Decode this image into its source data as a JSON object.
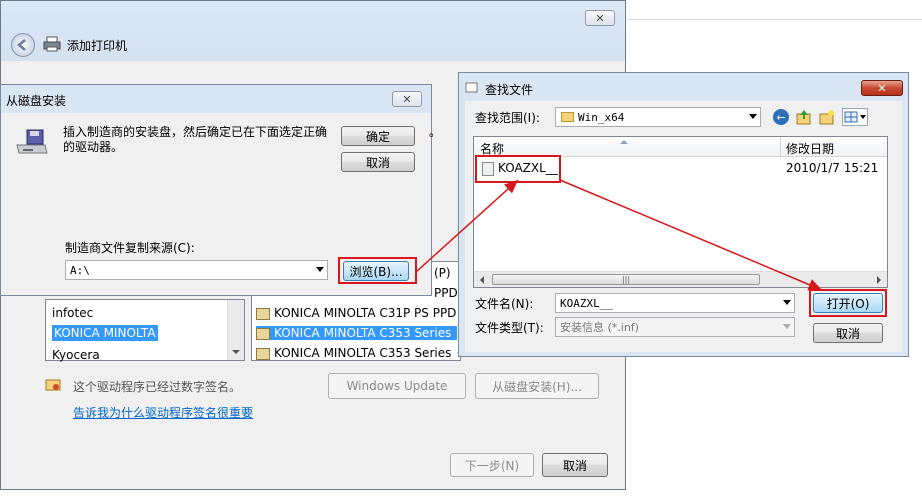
{
  "wizard": {
    "title": "添加打印机",
    "manufacturers": [
      "infotec",
      "KONICA MINOLTA",
      "Kyocera"
    ],
    "selected_manufacturer": "KONICA MINOLTA",
    "printers_partial": [
      "(P)",
      "PPD"
    ],
    "printers": [
      "KONICA MINOLTA C31P PS PPD",
      "KONICA MINOLTA C353 Series",
      "KONICA MINOLTA C353 Series"
    ],
    "signed_text": "这个驱动程序已经过数字签名。",
    "signing_link": "告诉我为什么驱动程序签名很重要",
    "windows_update": "Windows Update",
    "have_disk": "从磁盘安装(H)...",
    "next": "下一步(N)",
    "cancel": "取消",
    "close": "✕"
  },
  "disk_dialog": {
    "title": "从磁盘安装",
    "instruction": "插入制造商的安装盘，然后确定已在下面选定正确的驱动器。",
    "ok": "确定",
    "cancel": "取消",
    "copy_from_label": "制造商文件复制来源(C):",
    "copy_from_value": "A:\\",
    "browse": "浏览(B)...",
    "close": "✕",
    "trailing": "。"
  },
  "find_dialog": {
    "title": "查找文件",
    "look_in_label": "查找范围(I):",
    "look_in_value": "Win_x64",
    "col_name": "名称",
    "col_date": "修改日期",
    "file_name": "KOAZXL__",
    "file_date": "2010/1/7 15:21",
    "filename_label": "文件名(N):",
    "filename_value": "KOAZXL__",
    "filetype_label": "文件类型(T):",
    "filetype_value": "安装信息 (*.inf)",
    "open": "打开(O)",
    "cancel": "取消",
    "close": "✕",
    "scroll_grip": "|||"
  },
  "colors": {
    "highlight": "#3399ff",
    "annotation_red": "#d8161d",
    "dialog_bg": "#f0f0f0",
    "title_bar": "#dbe6f4",
    "link": "#0066cc"
  },
  "icons": [
    "back-arrow-icon",
    "printer-icon",
    "floppy-disk-icon",
    "folder-icon",
    "shield-warning-icon",
    "file-icon"
  ]
}
